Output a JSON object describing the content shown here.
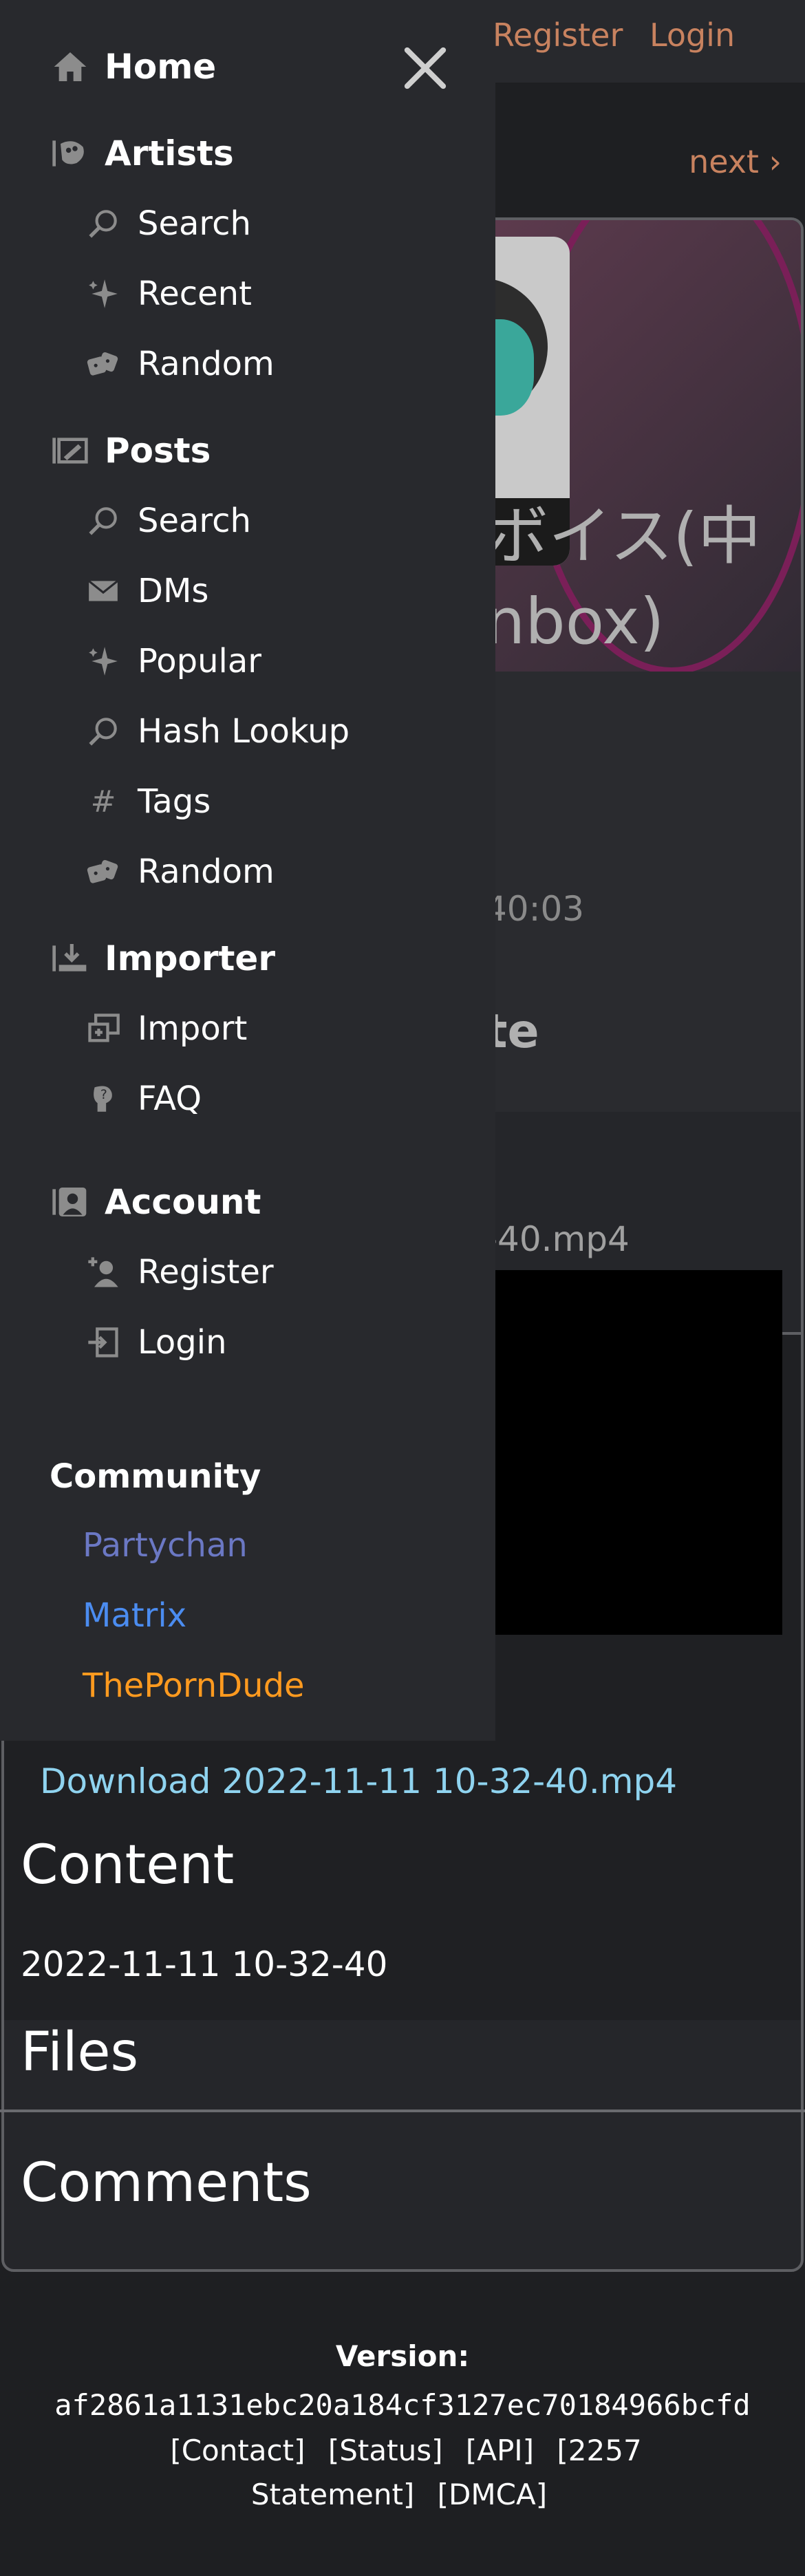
{
  "header": {
    "register_label": "Register",
    "login_label": "Login",
    "next_label": "next ›"
  },
  "post": {
    "title": "ボイス(中nbox)",
    "time_fragment": "40:03",
    "cut_text": "te",
    "file_fragment": "-40.mp4"
  },
  "download_label": "Download 2022-11-11 10-32-40.mp4",
  "content": {
    "heading": "Content",
    "text": "2022-11-11 10-32-40"
  },
  "files_heading": "Files",
  "comments_heading": "Comments",
  "footer": {
    "version_label": "Version:",
    "hash": "af2861a1131ebc20a184cf3127ec70184966bcfd",
    "links": [
      "[Contact]",
      "[Status]",
      "[API]",
      "[2257 Statement]",
      "[DMCA]"
    ]
  },
  "sidebar": {
    "home": "Home",
    "artists": {
      "label": "Artists",
      "items": [
        "Search",
        "Recent",
        "Random"
      ]
    },
    "posts": {
      "label": "Posts",
      "items": [
        "Search",
        "DMs",
        "Popular",
        "Hash Lookup",
        "Tags",
        "Random"
      ]
    },
    "importer": {
      "label": "Importer",
      "items": [
        "Import",
        "FAQ"
      ]
    },
    "account": {
      "label": "Account",
      "items": [
        "Register",
        "Login"
      ]
    },
    "community": {
      "label": "Community",
      "links": [
        {
          "label": "Partychan",
          "color": "#6b78c4"
        },
        {
          "label": "Matrix",
          "color": "#4b8cf0"
        },
        {
          "label": "ThePornDude",
          "color": "#ff9a1f"
        }
      ]
    }
  },
  "colors": {
    "accent": "#c8825f",
    "link": "#8fd3ef",
    "sidebar_bg": "#28292d"
  }
}
